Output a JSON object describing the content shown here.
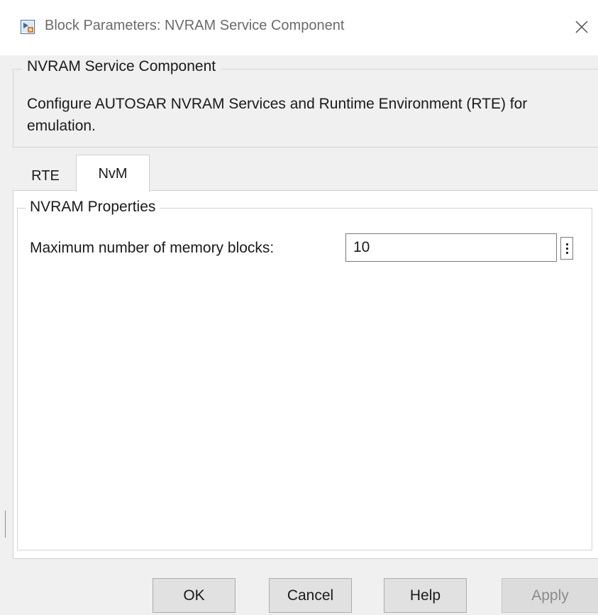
{
  "window": {
    "title": "Block Parameters: NVRAM Service Component",
    "icon": "simulink-block-icon",
    "close_icon": "close-icon"
  },
  "description_group": {
    "legend": "NVRAM Service Component",
    "text": "Configure AUTOSAR NVRAM Services and Runtime Environment (RTE) for emulation."
  },
  "tabs": [
    {
      "label": "RTE",
      "selected": false
    },
    {
      "label": "NvM",
      "selected": true
    }
  ],
  "nvram_properties": {
    "legend": "NVRAM Properties",
    "max_blocks_label": "Maximum number of memory blocks:",
    "max_blocks_value": "10",
    "more_options_icon": "vertical-ellipsis-icon"
  },
  "buttons": {
    "ok": "OK",
    "cancel": "Cancel",
    "help": "Help",
    "apply": "Apply",
    "apply_enabled": false
  },
  "colors": {
    "window_bg": "#f0f0f0",
    "panel_bg": "#ffffff",
    "group_border": "#d4d4d4",
    "button_bg": "#e1e1e1",
    "button_border": "#adadad",
    "disabled_text": "#8c8c8c",
    "title_text": "#6b6b6b"
  }
}
